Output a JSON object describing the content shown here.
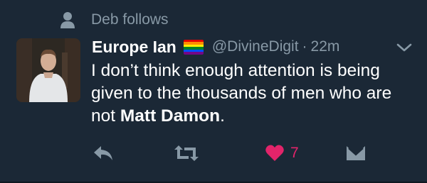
{
  "context": {
    "text": "Deb follows",
    "icon": "person-icon"
  },
  "author": {
    "display_name": "Europe Ian",
    "emoji": "rainbow-flag",
    "handle": "@DivineDigit",
    "separator": "·",
    "time": "22m"
  },
  "tweet": {
    "text_prefix": "I don’t think enough attention is being given to the thousands of men who are not ",
    "text_bold": "Matt Damon",
    "text_suffix": "."
  },
  "actions": {
    "like_count": "7"
  },
  "colors": {
    "background": "#1b2836",
    "secondary_text": "#8899a6",
    "like": "#e2246a"
  }
}
